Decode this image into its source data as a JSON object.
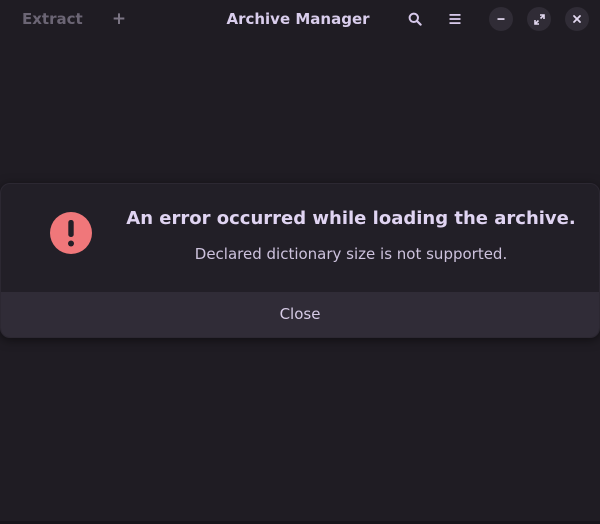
{
  "header": {
    "extract_label": "Extract",
    "add_label": "+",
    "title": "Archive Manager",
    "icons": {
      "search": "search-icon",
      "menu": "hamburger-menu-icon",
      "minimize": "minimize-icon",
      "maximize": "maximize-icon",
      "close": "close-icon"
    }
  },
  "error_dialog": {
    "icon": "error-icon",
    "heading": "An error occurred while loading the archive.",
    "message": "Declared dictionary size is not supported.",
    "close_label": "Close"
  },
  "colors": {
    "background": "#1f1c23",
    "error_red": "#f0777a",
    "text": "#d6c8ea"
  }
}
